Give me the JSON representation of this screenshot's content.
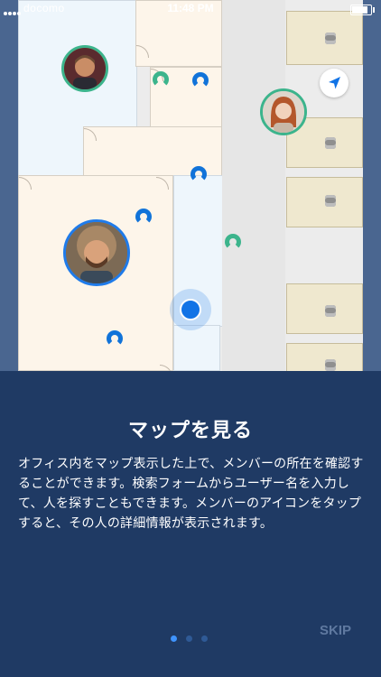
{
  "status_bar": {
    "carrier": "docomo",
    "time": "11:48 PM",
    "battery_level": 0.85,
    "signal_icon": "signal-dots-icon",
    "battery_icon": "battery-icon"
  },
  "map": {
    "locate_icon": "navigation-arrow-icon",
    "my_location_icon": "current-location-dot-icon",
    "member_pin_icon": "member-pin-icon",
    "device_icon": "printer-icon",
    "colors": {
      "map_bg": "#4a6690",
      "room_cream": "#fdf5ea",
      "room_blue": "#eef6fc",
      "room_olive": "#efe8cf",
      "pin_blue": "#1173d9",
      "pin_green": "#3cb48c",
      "avatar_ring_blue": "#1f7bea",
      "avatar_ring_green": "#3cb48c"
    }
  },
  "onboarding": {
    "title": "マップを見る",
    "description": "オフィス内をマップ表示した上で、メンバーの所在を確認することができます。検索フォームからユーザー名を入力して、人を探すこともできます。メンバーのアイコンをタップすると、その人の詳細情報が表示されます。",
    "page_count": 3,
    "current_page": 1,
    "skip_label": "SKIP",
    "colors": {
      "panel_bg": "#1f3a64",
      "dot_active": "#3f94ff",
      "dot_inactive": "#2f5a96",
      "skip_text": "#5f79a0"
    }
  }
}
